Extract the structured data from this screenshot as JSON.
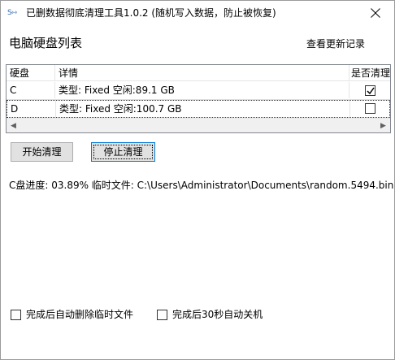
{
  "window": {
    "title": "已删数据彻底清理工具1.0.2 (随机写入数据，防止被恢复)",
    "icon": "app-icon"
  },
  "header": {
    "heading": "电脑硬盘列表",
    "history_link": "查看更新记录"
  },
  "disk_list": {
    "columns": [
      "硬盘",
      "详情",
      "是否清理"
    ],
    "rows": [
      {
        "disk": "C",
        "detail": "类型: Fixed 空闲:89.1 GB",
        "clean": true
      },
      {
        "disk": "D",
        "detail": "类型: Fixed 空闲:100.7 GB",
        "clean": false
      }
    ]
  },
  "buttons": {
    "start": "开始清理",
    "stop": "停止清理"
  },
  "status": {
    "progress_text": "C盘进度: 03.89% 临时文件: C:\\Users\\Administrator\\Documents\\random.5494.bin"
  },
  "options": {
    "delete_temp": {
      "label": "完成后自动删除临时文件",
      "checked": false
    },
    "shutdown": {
      "label": "完成后30秒自动关机",
      "checked": false
    }
  }
}
